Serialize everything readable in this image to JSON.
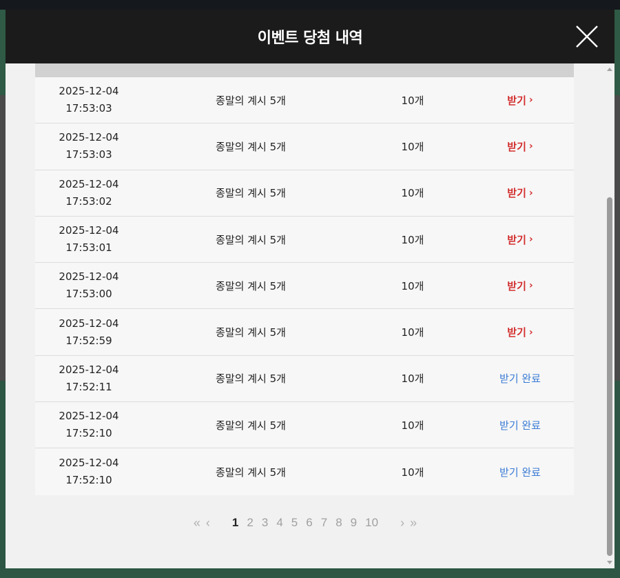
{
  "modal": {
    "title": "이벤트 당첨 내역"
  },
  "table": {
    "rows": [
      {
        "date": "2025-12-04",
        "time": "17:53:03",
        "item": "종말의 계시 5개",
        "qty": "10개",
        "status": "받기",
        "claimed": false
      },
      {
        "date": "2025-12-04",
        "time": "17:53:03",
        "item": "종말의 계시 5개",
        "qty": "10개",
        "status": "받기",
        "claimed": false
      },
      {
        "date": "2025-12-04",
        "time": "17:53:02",
        "item": "종말의 계시 5개",
        "qty": "10개",
        "status": "받기",
        "claimed": false
      },
      {
        "date": "2025-12-04",
        "time": "17:53:01",
        "item": "종말의 계시 5개",
        "qty": "10개",
        "status": "받기",
        "claimed": false
      },
      {
        "date": "2025-12-04",
        "time": "17:53:00",
        "item": "종말의 계시 5개",
        "qty": "10개",
        "status": "받기",
        "claimed": false
      },
      {
        "date": "2025-12-04",
        "time": "17:52:59",
        "item": "종말의 계시 5개",
        "qty": "10개",
        "status": "받기",
        "claimed": false
      },
      {
        "date": "2025-12-04",
        "time": "17:52:11",
        "item": "종말의 계시 5개",
        "qty": "10개",
        "status": "받기 완료",
        "claimed": true
      },
      {
        "date": "2025-12-04",
        "time": "17:52:10",
        "item": "종말의 계시 5개",
        "qty": "10개",
        "status": "받기 완료",
        "claimed": true
      },
      {
        "date": "2025-12-04",
        "time": "17:52:10",
        "item": "종말의 계시 5개",
        "qty": "10개",
        "status": "받기 완료",
        "claimed": true
      }
    ]
  },
  "pagination": {
    "first": "«",
    "prev": "‹",
    "pages": [
      "1",
      "2",
      "3",
      "4",
      "5",
      "6",
      "7",
      "8",
      "9",
      "10"
    ],
    "current": "1",
    "next": "›",
    "last": "»"
  },
  "colors": {
    "claim": "#d32f2f",
    "claimed": "#3a7bd5",
    "header_bg": "#1b1b1b"
  },
  "icons": {
    "close": "close-icon",
    "chevron": "chevron-right-icon"
  }
}
